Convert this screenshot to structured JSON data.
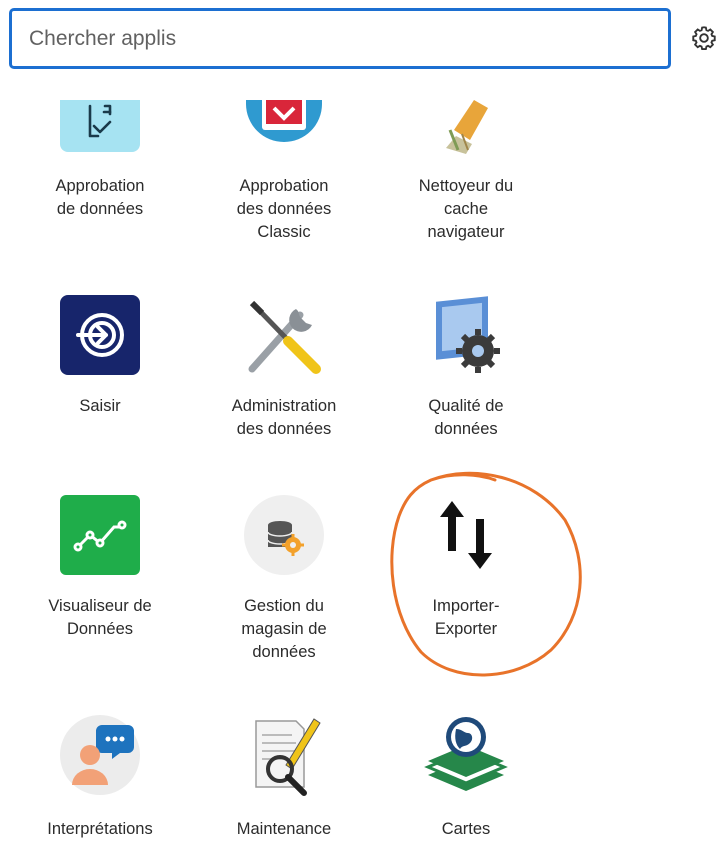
{
  "search": {
    "placeholder": "Chercher applis",
    "value": ""
  },
  "settings": {
    "icon": "gear-icon"
  },
  "apps": [
    {
      "id": "approbation-donnees",
      "lines": [
        "Approbation",
        "de données"
      ],
      "icon": "checklist-icon"
    },
    {
      "id": "approbation-classic",
      "lines": [
        "Approbation",
        "des données",
        "Classic"
      ],
      "icon": "approval-heart-icon"
    },
    {
      "id": "nettoyeur-cache",
      "lines": [
        "Nettoyeur du",
        "cache",
        "navigateur"
      ],
      "icon": "broom-icon"
    },
    {
      "id": "saisir",
      "lines": [
        "Saisir"
      ],
      "icon": "login-arrow-icon"
    },
    {
      "id": "administration-donnees",
      "lines": [
        "Administration",
        "des données"
      ],
      "icon": "tools-icon"
    },
    {
      "id": "qualite-donnees",
      "lines": [
        "Qualité de",
        "données"
      ],
      "icon": "window-gear-icon"
    },
    {
      "id": "visualiseur",
      "lines": [
        "Visualiseur de",
        "Données"
      ],
      "icon": "line-chart-icon"
    },
    {
      "id": "gestion-magasin",
      "lines": [
        "Gestion du",
        "magasin de",
        "données"
      ],
      "icon": "database-gear-icon"
    },
    {
      "id": "importer-exporter",
      "lines": [
        "Importer-",
        "Exporter"
      ],
      "icon": "import-export-arrows-icon"
    },
    {
      "id": "interpretations",
      "lines": [
        "Interprétations"
      ],
      "icon": "chat-person-icon"
    },
    {
      "id": "maintenance",
      "lines": [
        "Maintenance"
      ],
      "icon": "document-magnifier-icon"
    },
    {
      "id": "cartes",
      "lines": [
        "Cartes"
      ],
      "icon": "map-layers-icon"
    }
  ],
  "colors": {
    "search_border": "#1c6fd1",
    "annotation": "#e8732a"
  }
}
